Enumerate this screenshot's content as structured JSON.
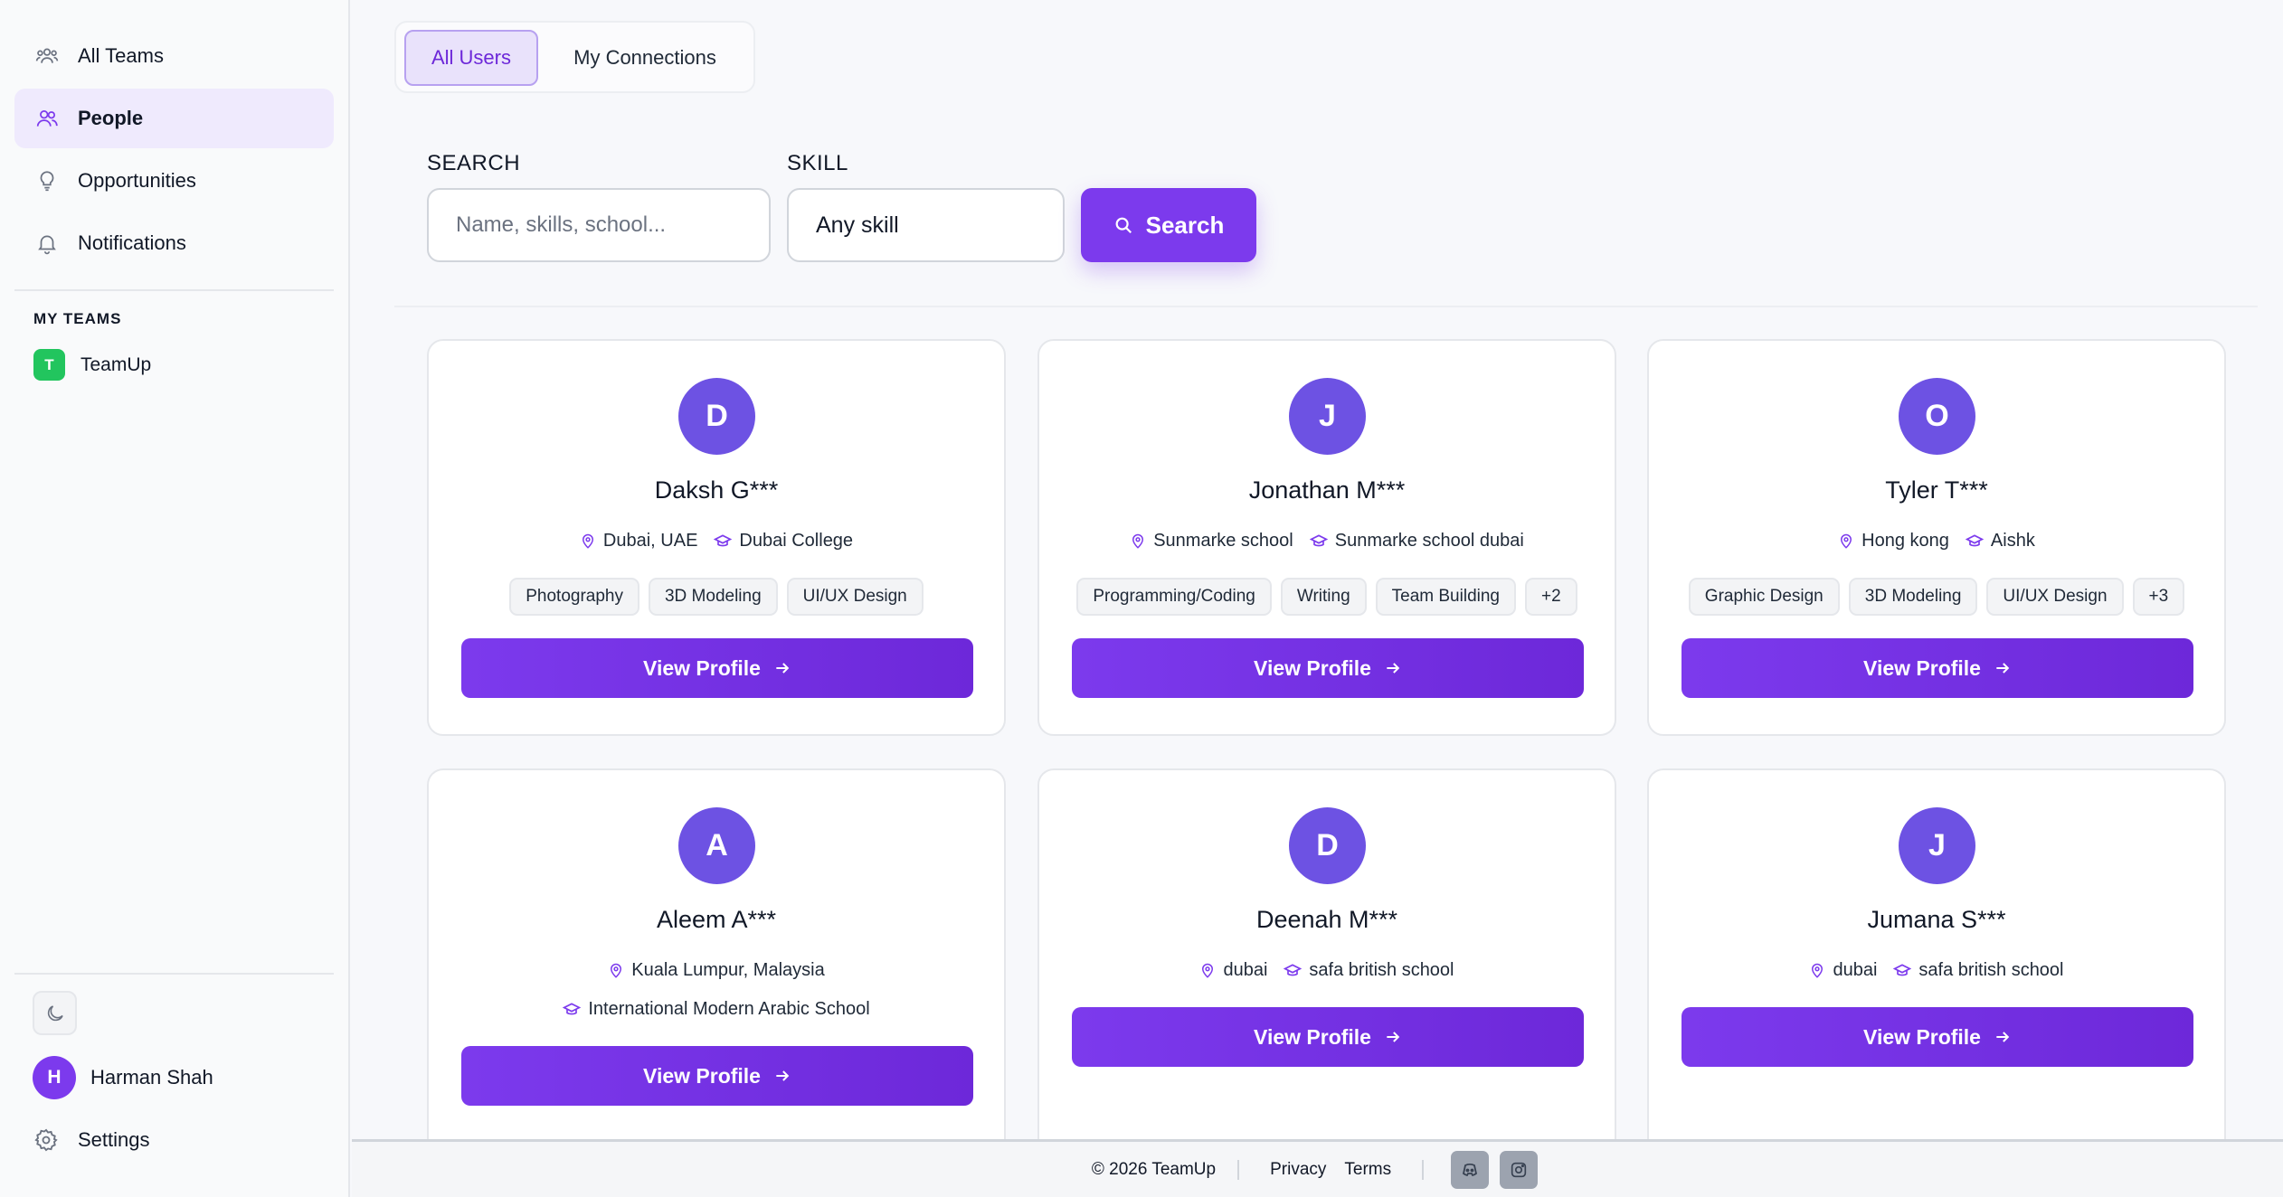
{
  "sidebar": {
    "nav": [
      {
        "label": "All Teams",
        "icon": "users-icon"
      },
      {
        "label": "People",
        "icon": "people-icon",
        "active": true
      },
      {
        "label": "Opportunities",
        "icon": "lightbulb-icon"
      },
      {
        "label": "Notifications",
        "icon": "bell-icon"
      }
    ],
    "my_teams_title": "MY TEAMS",
    "teams": [
      {
        "initial": "T",
        "name": "TeamUp",
        "color": "#22c55e"
      }
    ],
    "user": {
      "initial": "H",
      "name": "Harman Shah"
    },
    "settings_label": "Settings"
  },
  "tabs": {
    "all_users": "All Users",
    "my_connections": "My Connections"
  },
  "search": {
    "search_label": "SEARCH",
    "search_placeholder": "Name, skills, school...",
    "skill_label": "SKILL",
    "skill_value": "Any skill",
    "button_label": "Search"
  },
  "cards": [
    {
      "initial": "D",
      "name": "Daksh G***",
      "location": "Dubai, UAE",
      "school": "Dubai College",
      "tags": [
        "Photography",
        "3D Modeling",
        "UI/UX Design"
      ],
      "button": "View Profile"
    },
    {
      "initial": "J",
      "name": "Jonathan M***",
      "location": "Sunmarke school",
      "school": "Sunmarke school dubai",
      "tags": [
        "Programming/Coding",
        "Writing",
        "Team Building",
        "+2"
      ],
      "button": "View Profile"
    },
    {
      "initial": "O",
      "name": "Tyler T***",
      "location": "Hong kong",
      "school": "Aishk",
      "tags": [
        "Graphic Design",
        "3D Modeling",
        "UI/UX Design",
        "+3"
      ],
      "button": "View Profile"
    },
    {
      "initial": "A",
      "name": "Aleem A***",
      "location": "Kuala Lumpur, Malaysia",
      "school": "International Modern Arabic School",
      "tags": [],
      "button": "View Profile"
    },
    {
      "initial": "D",
      "name": "Deenah M***",
      "location": "dubai",
      "school": "safa british school",
      "tags": [],
      "button": "View Profile"
    },
    {
      "initial": "J",
      "name": "Jumana S***",
      "location": "dubai",
      "school": "safa british school",
      "tags": [],
      "button": "View Profile"
    }
  ],
  "footer": {
    "copyright": "© 2026 TeamUp",
    "privacy": "Privacy",
    "terms": "Terms",
    "social": [
      "discord-icon",
      "instagram-icon"
    ]
  },
  "colors": {
    "accent": "#7c3aed",
    "avatar": "#6d52e3",
    "team_badge": "#22c55e"
  }
}
